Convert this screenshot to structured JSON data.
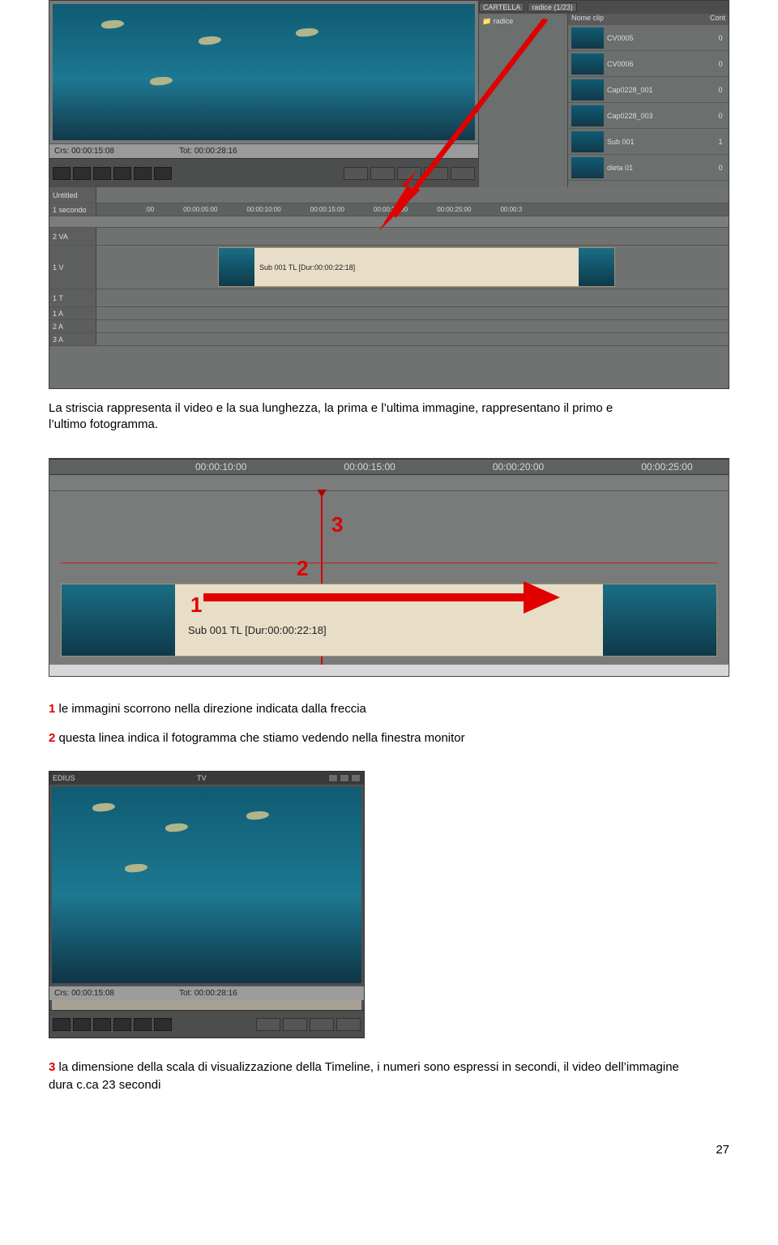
{
  "page_number": "27",
  "fig1": {
    "preview_time_in": "Crs: 00:00:15:08",
    "preview_time_out": "Tot: 00:00:28:16",
    "bin_tabs": {
      "cartella": "CARTELLA",
      "radice": "radice (1/23)"
    },
    "folder_root": "radice",
    "clip_list_header_name": "Nome clip",
    "clip_list_header_ct": "Cont",
    "clips": [
      {
        "name": "CV0005",
        "ct": "0"
      },
      {
        "name": "CV0006",
        "ct": "0"
      },
      {
        "name": "Cap0228_001",
        "ct": "0"
      },
      {
        "name": "Cap0228_003",
        "ct": "0"
      },
      {
        "name": "Sub 001",
        "ct": "1"
      },
      {
        "name": "dieta 01",
        "ct": "0"
      }
    ],
    "timeline_project": "Untitled",
    "timeline_scale": "1 secondo",
    "ruler": [
      ":00",
      "00:00:05:00",
      "00:00:10:00",
      "00:00:15:00",
      "00:00:20:00",
      "00:00:25:00",
      "00:00:3"
    ],
    "tracks": {
      "va2": "2 VA",
      "v1": "1 V",
      "t1": "1 T",
      "a1": "1 A",
      "a2": "2 A",
      "a3": "3 A"
    },
    "clip_label": "Sub 001 TL [Dur:00:00:22:18]"
  },
  "para1_a": "La striscia rappresenta il video e la sua lunghezza, la prima e l’ultima immagine, rappresentano il primo e",
  "para1_b": "l’ultimo fotogramma.",
  "fig2": {
    "ruler": [
      "",
      "00:00:10:00",
      "00:00:15:00",
      "00:00:20:00",
      "00:00:25:00"
    ],
    "clip_label": "Sub 001 TL [Dur:00:00:22:18]",
    "ann1": "1",
    "ann2": "2",
    "ann3": "3"
  },
  "legend": {
    "n1": "1",
    "t1": " le immagini scorrono nella direzione indicata dalla freccia",
    "n2": "2",
    "t2": " questa linea indica il fotogramma che stiamo vedendo nella finestra monitor",
    "n3": "3",
    "t3a": " la dimensione della scala di visualizzazione della Timeline, i numeri sono espressi in secondi, il video dell’immagine",
    "t3b": "dura c.ca 23 secondi"
  },
  "fig3": {
    "title": "EDIUS",
    "tab": "TV",
    "time_in": "Crs: 00:00:15:08",
    "time_out": "Tot: 00:00:28:16"
  }
}
